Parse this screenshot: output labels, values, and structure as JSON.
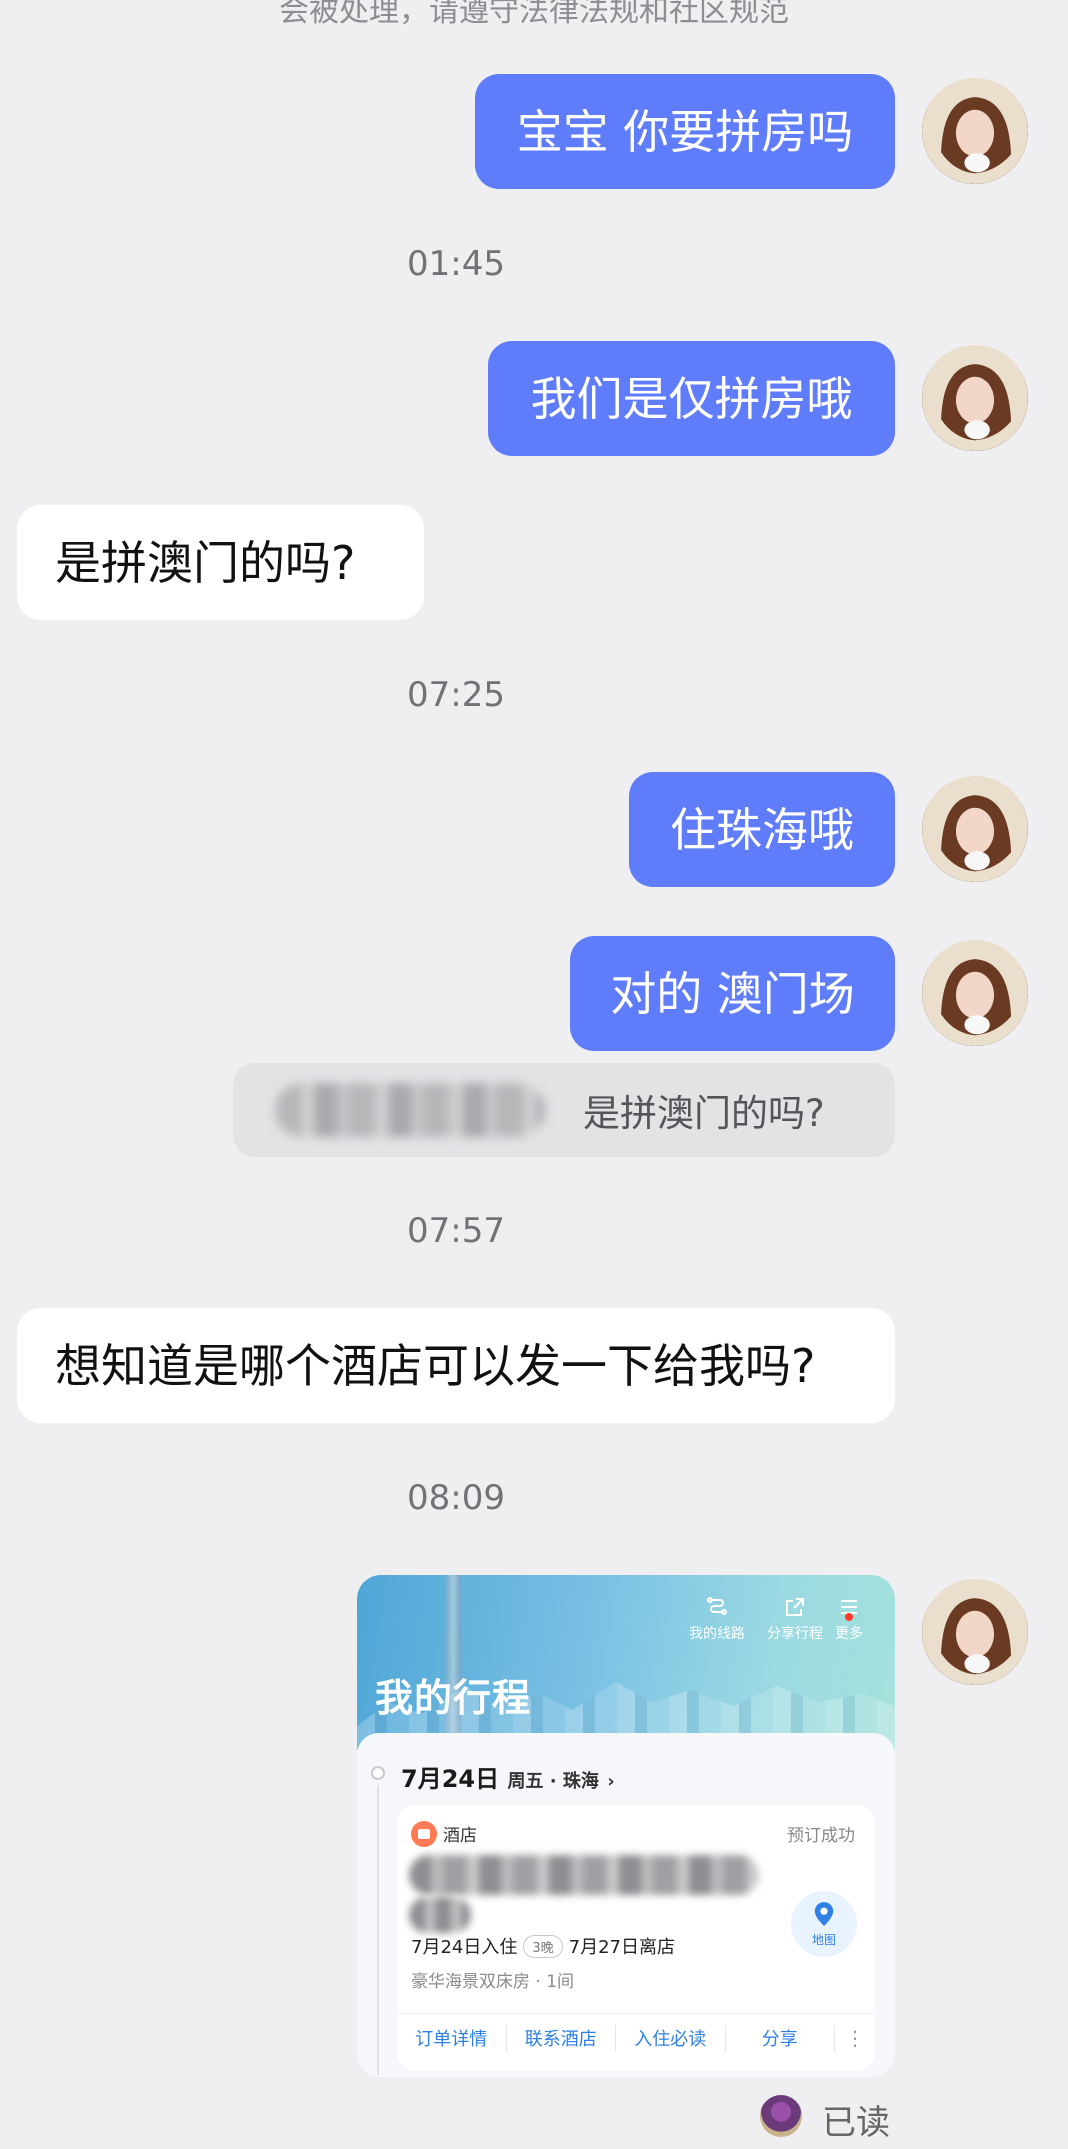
{
  "notice": "会被处理，请遵守法律法规和社区规范",
  "messages": [
    {
      "type": "sent",
      "text": "宝宝 你要拼房吗"
    },
    {
      "type": "time",
      "text": "01:45"
    },
    {
      "type": "sent",
      "text": "我们是仅拼房哦"
    },
    {
      "type": "received",
      "text": "是拼澳门的吗?"
    },
    {
      "type": "time",
      "text": "07:25"
    },
    {
      "type": "sent",
      "text": "住珠海哦"
    },
    {
      "type": "sent",
      "text": "对的 澳门场"
    },
    {
      "type": "quote",
      "text": "是拼澳门的吗?"
    },
    {
      "type": "time",
      "text": "07:57"
    },
    {
      "type": "received",
      "text": "想知道是哪个酒店可以发一下给我吗?"
    },
    {
      "type": "time",
      "text": "08:09"
    }
  ],
  "trip_card": {
    "title": "我的行程",
    "top_actions": [
      "我的线路",
      "分享行程",
      "更多"
    ],
    "date": "7月24日",
    "date_sub": "周五 · 珠海",
    "hotel_type": "酒店",
    "status": "预订成功",
    "map_label": "地图",
    "checkin": "7月24日入住",
    "nights": "3晚",
    "checkout": "7月27日离店",
    "room": "豪华海景双床房 · 1间",
    "actions": [
      "订单详情",
      "联系酒店",
      "入住必读",
      "分享"
    ]
  },
  "read_status": "已读",
  "icons": {
    "avatar": "user-avatar-icon",
    "route": "route-icon",
    "share": "share-icon",
    "menu": "menu-icon",
    "map": "map-pin-icon",
    "hotel": "hotel-icon"
  },
  "colors": {
    "background": "#efeff1",
    "sent_bubble": "#5f7cfa",
    "received_bubble": "#ffffff",
    "link_blue": "#2f80e5"
  }
}
